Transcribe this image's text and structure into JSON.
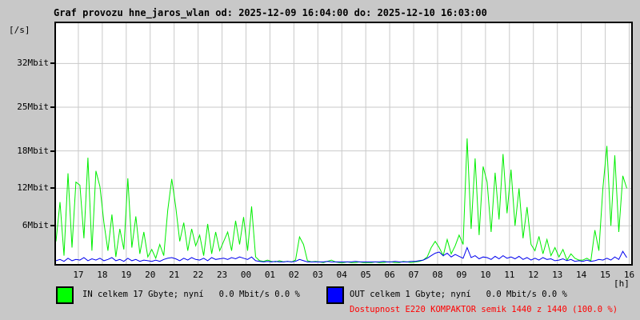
{
  "header": {
    "title": "Graf provozu hne_jaros_wlan od: 2025-12-09 16:04:00 do: 2025-12-10 16:03:00"
  },
  "axis": {
    "unit_label": "[/s]",
    "hours_label": "[h]"
  },
  "legend": {
    "in_label": "IN celkem 17 Gbyte; nyní   0.0 Mbit/s 0.0 %",
    "in_color": "#00ff00",
    "out_label": "OUT celkem 1 Gbyte; nyní   0.0 Mbit/s 0.0 %",
    "out_color": "#0000ff"
  },
  "availability": {
    "text": "Dostupnost E220 KOMPAKTOR semik 1440 z 1440 (100.0 %)",
    "color": "#ff0000"
  },
  "chart_data": {
    "type": "line",
    "title": "Graf provozu hne_jaros_wlan od: 2025-12-09 16:04:00 do: 2025-12-10 16:03:00",
    "x_start": "2025-12-09 16:04:00",
    "x_end": "2025-12-10 16:03:00",
    "xlabel": "[h]",
    "ylabel": "[/s]",
    "ylim": [
      0,
      38.5
    ],
    "grid": true,
    "legend_position": "bottom",
    "xticks": [
      "17",
      "18",
      "19",
      "20",
      "21",
      "22",
      "23",
      "00",
      "01",
      "02",
      "03",
      "04",
      "05",
      "06",
      "07",
      "08",
      "09",
      "10",
      "11",
      "12",
      "13",
      "14",
      "15",
      "16"
    ],
    "ytick_values": [
      6,
      12,
      18,
      25,
      32
    ],
    "ytick_labels": [
      "6Mbit",
      "12Mbit",
      "18Mbit",
      "25Mbit",
      "32Mbit"
    ],
    "sample_interval_minutes": 10,
    "total_minutes": 1439,
    "first_tick_offset_minutes": 56,
    "series": [
      {
        "name": "IN",
        "unit": "Mbit/s",
        "color": "#00ee00",
        "total": "17 Gbyte",
        "now": "0.0 Mbit/s 0.0 %",
        "values": [
          3.5,
          9.8,
          1.2,
          14.4,
          2.5,
          13.0,
          12.5,
          4.0,
          16.9,
          2.0,
          14.8,
          12.3,
          6.5,
          2.0,
          7.8,
          1.0,
          5.5,
          2.2,
          13.6,
          2.5,
          7.5,
          1.5,
          5.0,
          1.0,
          2.2,
          0.8,
          3.0,
          1.2,
          8.5,
          13.5,
          9.0,
          3.5,
          6.5,
          2.0,
          5.5,
          2.8,
          4.5,
          1.2,
          6.3,
          1.5,
          5.0,
          2.0,
          3.5,
          5.0,
          2.0,
          6.8,
          3.0,
          7.4,
          2.0,
          9.1,
          1.0,
          0.4,
          0.3,
          0.5,
          0.3,
          0.2,
          0.4,
          0.2,
          0.3,
          0.2,
          0.5,
          4.2,
          3.0,
          0.4,
          0.2,
          0.3,
          0.2,
          0.1,
          0.3,
          0.5,
          0.2,
          0.1,
          0.1,
          0.2,
          0.1,
          0.1,
          0.2,
          0.1,
          0.1,
          0.1,
          0.2,
          0.1,
          0.1,
          0.2,
          0.2,
          0.1,
          0.1,
          0.3,
          0.2,
          0.1,
          0.2,
          0.3,
          0.5,
          1.0,
          2.5,
          3.5,
          2.5,
          1.2,
          3.8,
          1.5,
          2.8,
          4.5,
          3.0,
          20.0,
          5.5,
          16.8,
          4.5,
          15.5,
          13.0,
          5.0,
          14.5,
          7.0,
          17.5,
          8.0,
          15.0,
          6.0,
          12.0,
          4.0,
          9.0,
          3.0,
          2.0,
          4.3,
          1.5,
          3.8,
          1.2,
          2.5,
          1.0,
          2.2,
          0.5,
          1.5,
          0.8,
          0.5,
          0.5,
          0.8,
          0.4,
          5.3,
          2.0,
          12.0,
          18.8,
          6.0,
          17.3,
          5.0,
          14.0,
          12.0
        ]
      },
      {
        "name": "OUT",
        "unit": "Mbit/s",
        "color": "#0000ee",
        "total": "1 Gbyte",
        "now": "0.0 Mbit/s 0.0 %",
        "values": [
          0.4,
          0.6,
          0.3,
          0.8,
          0.4,
          0.6,
          0.5,
          0.9,
          0.4,
          0.7,
          0.5,
          0.8,
          0.4,
          0.6,
          0.9,
          0.4,
          0.6,
          0.3,
          0.8,
          0.4,
          0.6,
          0.3,
          0.5,
          0.4,
          0.3,
          0.5,
          0.3,
          0.6,
          0.8,
          0.9,
          0.7,
          0.4,
          0.8,
          0.5,
          0.9,
          0.6,
          0.5,
          0.8,
          0.4,
          0.9,
          0.6,
          0.7,
          0.8,
          0.6,
          0.9,
          0.7,
          1.0,
          0.8,
          0.6,
          1.0,
          0.4,
          0.3,
          0.2,
          0.3,
          0.2,
          0.3,
          0.2,
          0.2,
          0.3,
          0.2,
          0.3,
          0.6,
          0.4,
          0.2,
          0.2,
          0.2,
          0.2,
          0.2,
          0.3,
          0.2,
          0.2,
          0.2,
          0.2,
          0.2,
          0.2,
          0.3,
          0.2,
          0.2,
          0.2,
          0.2,
          0.2,
          0.2,
          0.3,
          0.2,
          0.2,
          0.3,
          0.2,
          0.2,
          0.2,
          0.3,
          0.3,
          0.4,
          0.5,
          0.8,
          1.2,
          1.6,
          1.8,
          1.2,
          1.6,
          1.0,
          1.4,
          1.1,
          0.8,
          2.5,
          0.9,
          1.2,
          0.7,
          1.0,
          0.9,
          0.6,
          1.1,
          0.7,
          1.2,
          0.8,
          1.0,
          0.7,
          1.1,
          0.6,
          0.9,
          0.5,
          0.8,
          0.5,
          0.9,
          0.6,
          0.7,
          0.4,
          0.5,
          0.7,
          0.4,
          0.6,
          0.3,
          0.4,
          0.3,
          0.5,
          0.3,
          0.4,
          0.6,
          0.5,
          0.8,
          0.5,
          1.0,
          0.6,
          1.9,
          0.9
        ]
      }
    ],
    "colors": {
      "grid": "#c9c9c9",
      "frame": "#000000",
      "plot_bg": "#ffffff",
      "page_bg": "#c8c8c8"
    }
  }
}
